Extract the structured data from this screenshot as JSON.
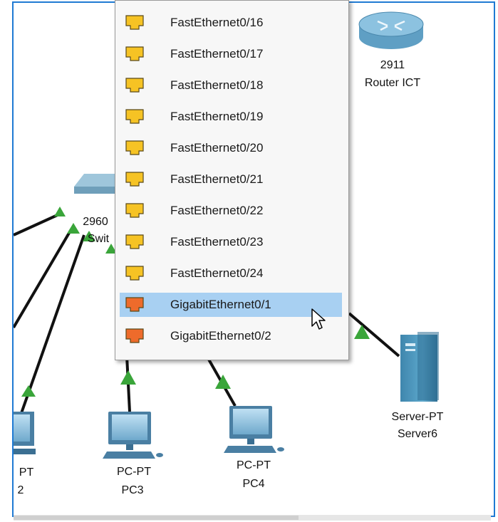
{
  "canvas": {
    "devices": {
      "router": {
        "model": "2911",
        "name": "Router ICT",
        "icon": "router-icon"
      },
      "switch": {
        "model": "2960",
        "name": "Swit",
        "icon": "switch-icon"
      },
      "pc2": {
        "model": "PT",
        "name": "2",
        "icon": "pc-icon"
      },
      "pc3": {
        "model": "PC-PT",
        "name": "PC3",
        "icon": "pc-icon"
      },
      "pc4": {
        "model": "PC-PT",
        "name": "PC4",
        "icon": "pc-icon"
      },
      "server": {
        "model": "Server-PT",
        "name": "Server6",
        "icon": "server-icon"
      }
    },
    "link_status_color": "#3aa53a",
    "cable_color": "#111111"
  },
  "port_menu": {
    "items": [
      {
        "label": "FastEthernet0/16",
        "type": "fast"
      },
      {
        "label": "FastEthernet0/17",
        "type": "fast"
      },
      {
        "label": "FastEthernet0/18",
        "type": "fast"
      },
      {
        "label": "FastEthernet0/19",
        "type": "fast"
      },
      {
        "label": "FastEthernet0/20",
        "type": "fast"
      },
      {
        "label": "FastEthernet0/21",
        "type": "fast"
      },
      {
        "label": "FastEthernet0/22",
        "type": "fast"
      },
      {
        "label": "FastEthernet0/23",
        "type": "fast"
      },
      {
        "label": "FastEthernet0/24",
        "type": "fast"
      },
      {
        "label": "GigabitEthernet0/1",
        "type": "gigabit",
        "highlighted": true
      },
      {
        "label": "GigabitEthernet0/2",
        "type": "gigabit"
      }
    ],
    "port_colors": {
      "fast": "#f6c324",
      "gigabit": "#ee6b2b"
    },
    "highlight_color": "#a8d0f2"
  }
}
